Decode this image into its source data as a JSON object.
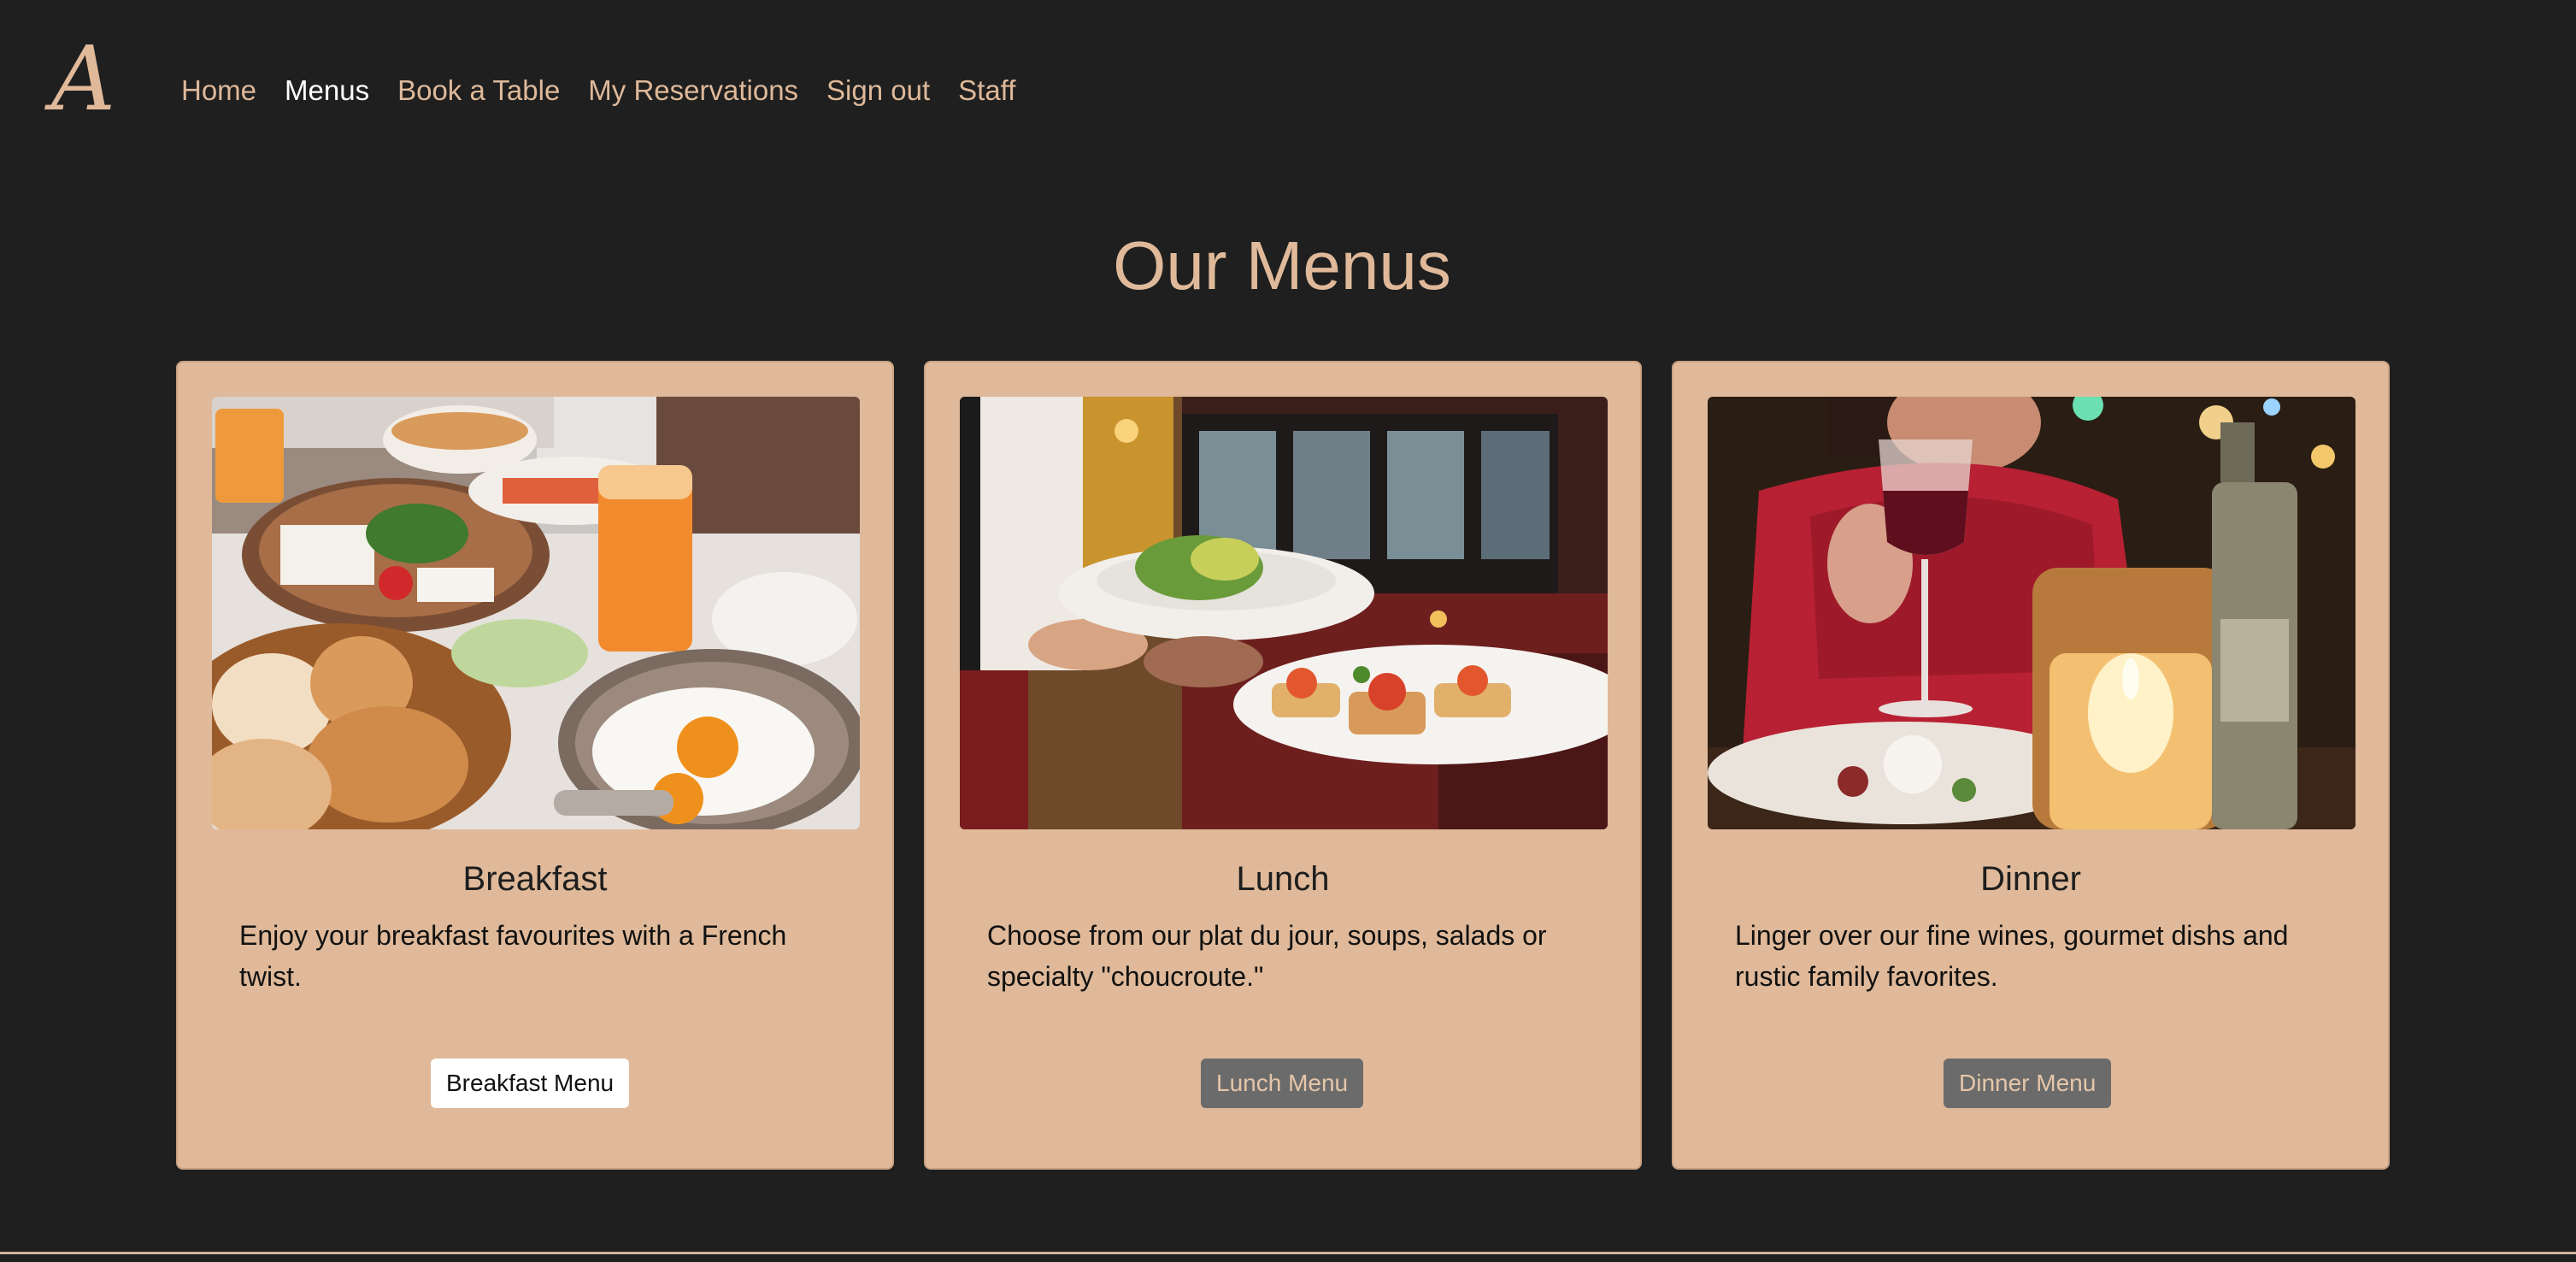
{
  "nav": {
    "brand_letter": "A",
    "links": [
      {
        "label": "Home"
      },
      {
        "label": "Menus"
      },
      {
        "label": "Book a Table"
      },
      {
        "label": "My Reservations"
      },
      {
        "label": "Sign out"
      },
      {
        "label": "Staff"
      }
    ],
    "active": "Menus"
  },
  "page": {
    "title": "Our Menus"
  },
  "cards": [
    {
      "title": "Breakfast",
      "text": "Enjoy your breakfast favourites with a French twist.",
      "button_label": "Breakfast Menu",
      "image_subject": "breakfast-table-photo"
    },
    {
      "title": "Lunch",
      "text": "Choose from our plat du jour, soups, salads or specialty \"choucroute.\"",
      "button_label": "Lunch Menu",
      "image_subject": "waiter-serving-plates-photo"
    },
    {
      "title": "Dinner",
      "text": "Linger over our fine wines, gourmet dishs and rustic family favorites.",
      "button_label": "Dinner Menu",
      "image_subject": "candlelit-wine-dinner-photo"
    }
  ],
  "colors": {
    "background": "#1f1f1f",
    "accent": "#dfb999",
    "nav_active": "#ffffff",
    "button_dark": "#6b6b6b",
    "button_light": "#ffffff"
  }
}
